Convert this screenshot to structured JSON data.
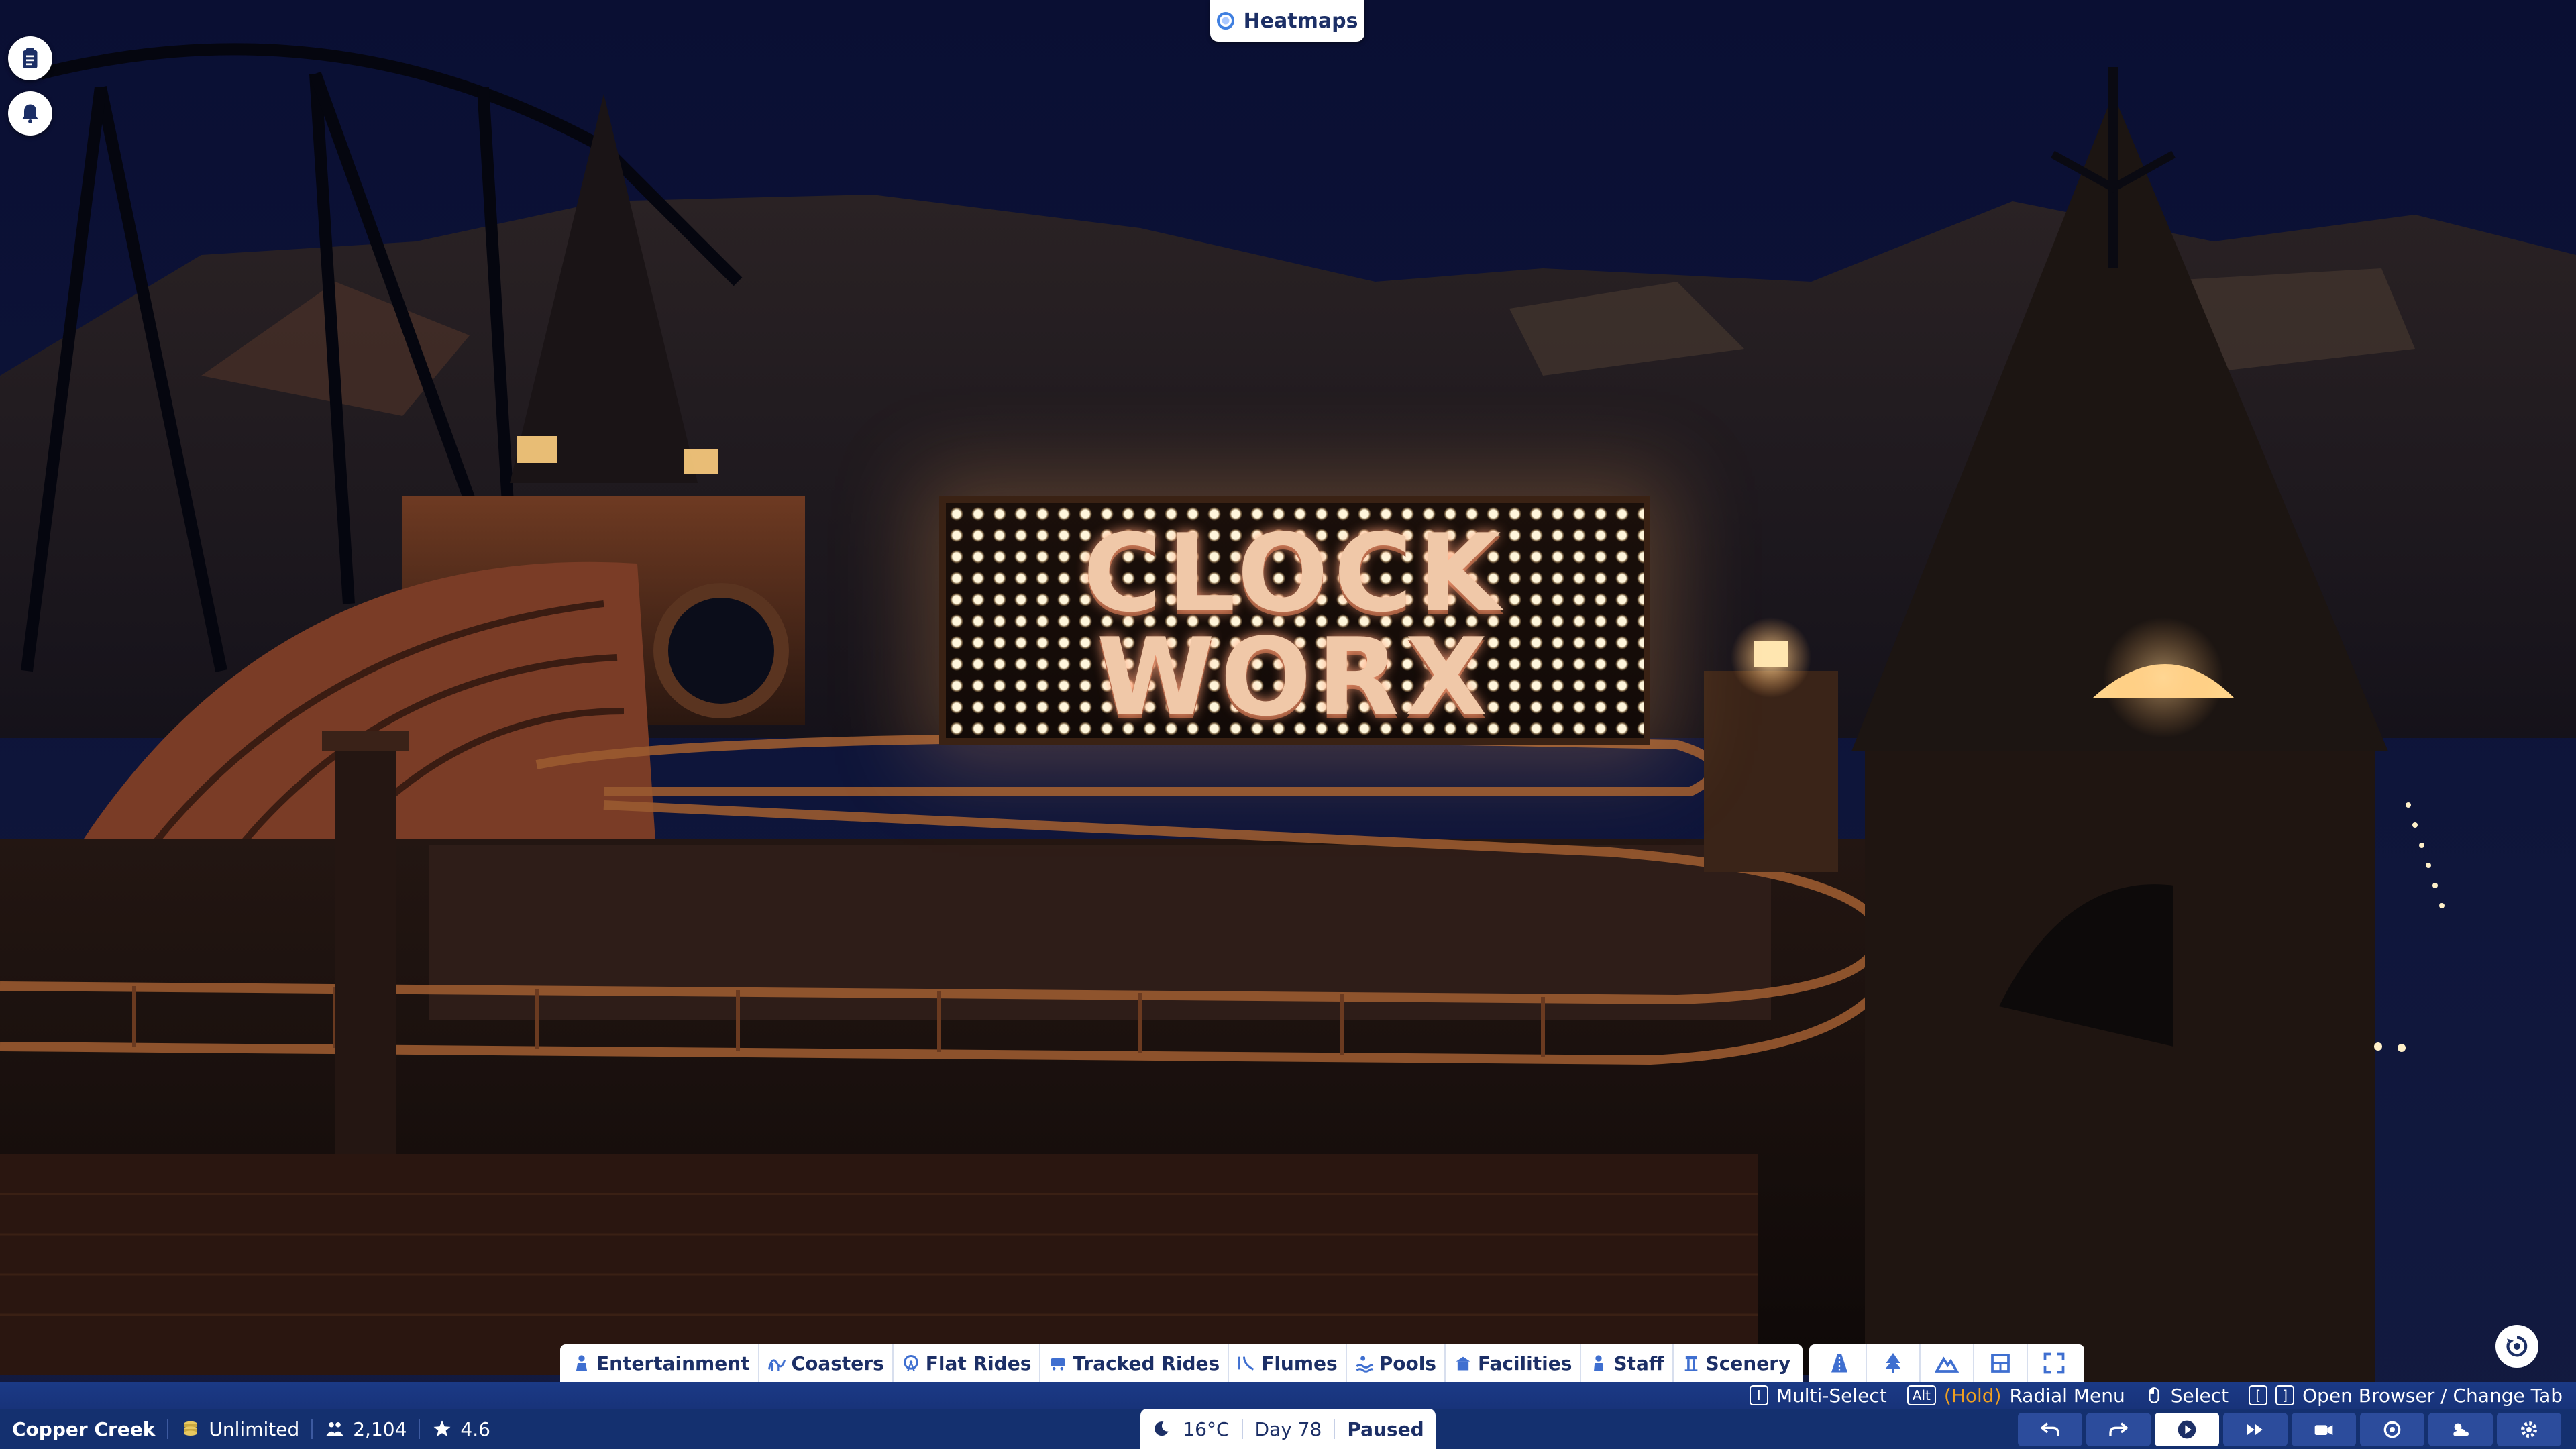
{
  "top_bar": {
    "heatmaps_label": "Heatmaps"
  },
  "left_buttons": [
    {
      "name": "clipboard-icon"
    },
    {
      "name": "bell-icon"
    }
  ],
  "scene": {
    "sign_line_1": "CLOCK",
    "sign_line_2": "WORX"
  },
  "build_toolbar": {
    "categories": [
      {
        "label": "Entertainment",
        "icon": "entertainer-icon"
      },
      {
        "label": "Coasters",
        "icon": "coaster-icon"
      },
      {
        "label": "Flat Rides",
        "icon": "flat-ride-icon"
      },
      {
        "label": "Tracked Rides",
        "icon": "tracked-ride-icon"
      },
      {
        "label": "Flumes",
        "icon": "flume-icon"
      },
      {
        "label": "Pools",
        "icon": "pool-icon"
      },
      {
        "label": "Facilities",
        "icon": "facility-icon"
      },
      {
        "label": "Staff",
        "icon": "staff-icon"
      },
      {
        "label": "Scenery",
        "icon": "scenery-icon"
      }
    ],
    "tools": [
      "path-tool-icon",
      "tree-tool-icon",
      "terrain-tool-icon",
      "blueprint-tool-icon",
      "fullscreen-icon"
    ]
  },
  "hints": {
    "multi_select_key": "I",
    "multi_select": "Multi-Select",
    "radial_key": "Alt",
    "radial_hold": "(Hold)",
    "radial": "Radial Menu",
    "select": "Select",
    "browser_key_left": "[",
    "browser_key_right": "]",
    "browser": "Open Browser / Change Tab"
  },
  "status": {
    "park_name": "Copper Creek",
    "money": "Unlimited",
    "guests": "2,104",
    "rating": "4.6",
    "temperature": "16°C",
    "day": "Day 78",
    "state": "Paused"
  },
  "colors": {
    "hud_blue": "#14306f",
    "hud_text": "#1c2f66",
    "accent_orange": "#f0a020",
    "sky": "#0b1030"
  }
}
